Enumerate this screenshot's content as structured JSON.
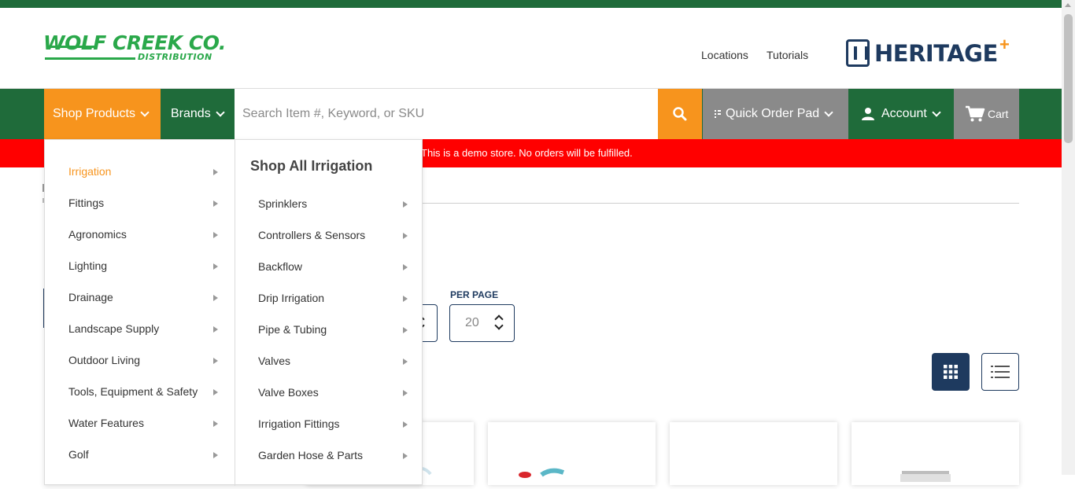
{
  "header": {
    "logo_main": "WOLF CREEK CO.",
    "logo_sub": "DISTRIBUTION",
    "links": [
      "Locations",
      "Tutorials"
    ],
    "partner_logo": "HERITAGE",
    "partner_plus": "+"
  },
  "nav": {
    "shop_products": "Shop Products",
    "brands": "Brands",
    "search_placeholder": "Search Item #, Keyword, or SKU",
    "quick_order_pad": "Quick Order Pad",
    "account": "Account",
    "cart": "Cart"
  },
  "banner": {
    "text": "This is a demo store. No orders will be fulfilled."
  },
  "toolbar": {
    "per_page_label": "PER PAGE",
    "per_page_value": "20"
  },
  "menu": {
    "categories": [
      {
        "label": "Irrigation",
        "active": true
      },
      {
        "label": "Fittings"
      },
      {
        "label": "Agronomics"
      },
      {
        "label": "Lighting"
      },
      {
        "label": "Drainage"
      },
      {
        "label": "Landscape Supply"
      },
      {
        "label": "Outdoor Living"
      },
      {
        "label": "Tools, Equipment & Safety"
      },
      {
        "label": "Water Features"
      },
      {
        "label": "Golf"
      }
    ],
    "sub_title": "Shop All Irrigation",
    "subcategories": [
      "Sprinklers",
      "Controllers & Sensors",
      "Backflow",
      "Drip Irrigation",
      "Pipe & Tubing",
      "Valves",
      "Valve Boxes",
      "Irrigation Fittings",
      "Garden Hose & Parts"
    ]
  },
  "colors": {
    "brand_green": "#1f6b3a",
    "accent_orange": "#f7941d",
    "demo_red": "#ff0000",
    "navy": "#1e3a5f",
    "gray": "#8a8a8a"
  }
}
